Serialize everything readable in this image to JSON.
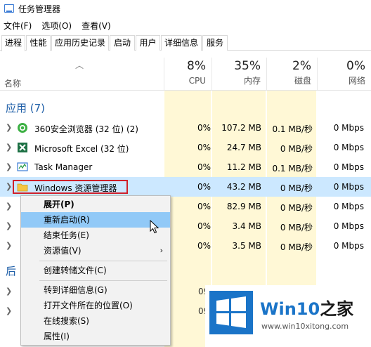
{
  "window": {
    "title": "任务管理器"
  },
  "menu": [
    "文件(F)",
    "选项(O)",
    "查看(V)"
  ],
  "tabs": [
    "进程",
    "性能",
    "应用历史记录",
    "启动",
    "用户",
    "详细信息",
    "服务"
  ],
  "header": {
    "name_label": "名称",
    "cpu": {
      "pct": "8%",
      "label": "CPU"
    },
    "memory": {
      "pct": "35%",
      "label": "内存"
    },
    "disk": {
      "pct": "2%",
      "label": "磁盘"
    },
    "network": {
      "pct": "0%",
      "label": "网络"
    }
  },
  "group_apps": "应用 (7)",
  "group_background_partial": "后",
  "rows": [
    {
      "name": "360安全浏览器 (32 位) (2)",
      "cpu": "0%",
      "mem": "107.2 MB",
      "disk": "0.1 MB/秒",
      "net": "0 Mbps",
      "icon": "360-browser-icon"
    },
    {
      "name": "Microsoft Excel (32 位)",
      "cpu": "0%",
      "mem": "24.7 MB",
      "disk": "0 MB/秒",
      "net": "0 Mbps",
      "icon": "excel-icon"
    },
    {
      "name": "Task Manager",
      "cpu": "0%",
      "mem": "11.2 MB",
      "disk": "0.1 MB/秒",
      "net": "0 Mbps",
      "icon": "task-manager-icon"
    },
    {
      "name": "Windows 资源管理器",
      "cpu": "0%",
      "mem": "43.2 MB",
      "disk": "0 MB/秒",
      "net": "0 Mbps",
      "icon": "folder-icon"
    },
    {
      "name": "",
      "cpu": "0%",
      "mem": "82.9 MB",
      "disk": "0 MB/秒",
      "net": "0 Mbps"
    },
    {
      "name": "",
      "cpu": "0%",
      "mem": "3.4 MB",
      "disk": "0 MB/秒",
      "net": "0 Mbps"
    },
    {
      "name": "",
      "cpu": "0%",
      "mem": "3.5 MB",
      "disk": "0 MB/秒",
      "net": "0 Mbps"
    }
  ],
  "partial_cpu": [
    "09",
    "09"
  ],
  "context_menu": {
    "expand": "展开(P)",
    "restart": "重新启动(R)",
    "end_task": "结束任务(E)",
    "resource_values": "资源值(V)",
    "create_dump": "创建转储文件(C)",
    "goto_details": "转到详细信息(G)",
    "open_location": "打开文件所在的位置(O)",
    "search_online": "在线搜索(S)",
    "properties": "属性(I)"
  },
  "watermark": {
    "brand_a": "Win10",
    "brand_b": "之家",
    "url": "www.win10xitong.com"
  },
  "colors": {
    "data_highlight": "#fff8d6",
    "selected_row": "#cce8ff",
    "menu_highlight": "#91c9f7",
    "accent_blue": "#1a74c8",
    "red_box": "#d0202a"
  }
}
